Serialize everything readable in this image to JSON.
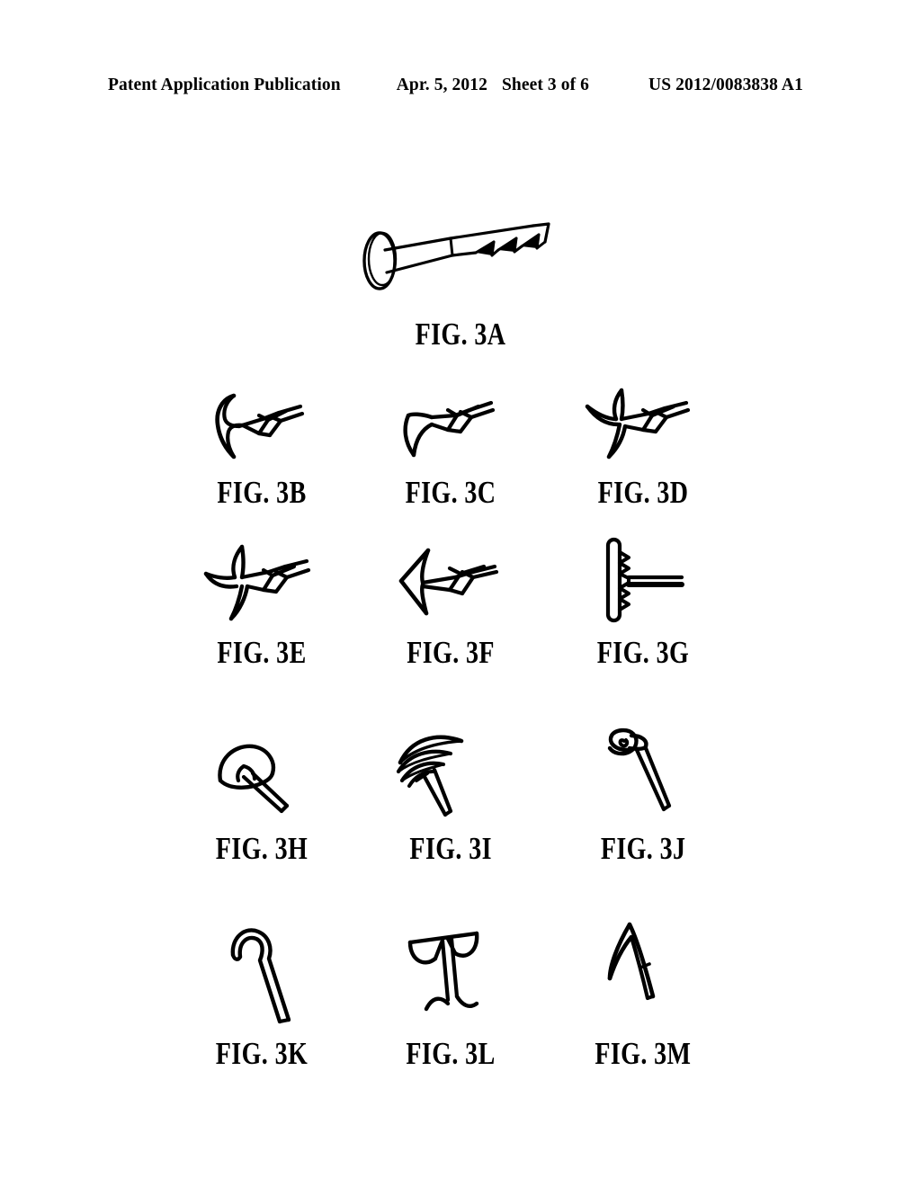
{
  "page": {
    "background_color": "#ffffff",
    "ink_color": "#000000"
  },
  "header": {
    "publication_title": "Patent Application Publication",
    "date": "Apr. 5, 2012",
    "sheet": "Sheet 3 of 6",
    "publication_number": "US 2012/0083838 A1"
  },
  "figures": [
    {
      "id": "3A",
      "label": "FIG. 3A",
      "icon": "barbed-shaft-with-disc-head-figure",
      "description": "Elongate anchor shaft with a round disc-shaped head at the proximal end and a series of rearward-facing barbs along the distal portion"
    },
    {
      "id": "3B",
      "label": "FIG. 3B",
      "icon": "hooked-tip-barbed-anchor-figure",
      "description": "Anchor with a curved hook-shaped distal tip and two rearward-facing barbs on the shaft"
    },
    {
      "id": "3C",
      "label": "FIG. 3C",
      "icon": "curved-blade-tip-barbed-anchor-figure",
      "description": "Anchor with a slender curved blade tip and two rearward-facing barbs on the shaft"
    },
    {
      "id": "3D",
      "label": "FIG. 3D",
      "icon": "three-prong-tip-barbed-anchor-figure",
      "description": "Anchor with a three-pronged splayed distal tip and rearward-facing barbs on the shaft"
    },
    {
      "id": "3E",
      "label": "FIG. 3E",
      "icon": "four-prong-tip-barbed-anchor-figure",
      "description": "Anchor with a four-pronged splayed distal tip and rearward-facing barbs on the shaft"
    },
    {
      "id": "3F",
      "label": "FIG. 3F",
      "icon": "arrowhead-tip-barbed-anchor-figure",
      "description": "Anchor with a chevron arrowhead distal tip and two rearward-facing barbs on the shaft"
    },
    {
      "id": "3G",
      "label": "FIG. 3G",
      "icon": "t-bar-toggle-anchor-figure",
      "description": "T-shaped toggle anchor with a vertical crossbar and a serrated zigzag connection to the lateral shaft"
    },
    {
      "id": "3H",
      "label": "FIG. 3H",
      "icon": "mushroom-cap-anchor-figure",
      "description": "Anchor with a mushroom or umbrella shaped cap mounted on an angled shaft"
    },
    {
      "id": "3I",
      "label": "FIG. 3I",
      "icon": "splayed-umbrella-rib-anchor-figure",
      "description": "Anchor with multiple splayed radiating ribs forming a fanned umbrella at the end of a shaft"
    },
    {
      "id": "3J",
      "label": "FIG. 3J",
      "icon": "coiled-loop-head-anchor-figure",
      "description": "Anchor with a coiled spiral loop head at the proximal end of a straight shaft"
    },
    {
      "id": "3K",
      "label": "FIG. 3K",
      "icon": "shepherds-hook-anchor-figure",
      "description": "Anchor formed as a shepherd's crook with a rounded hook at the proximal end of a straight shaft"
    },
    {
      "id": "3L",
      "label": "FIG. 3L",
      "icon": "t-shaped-wing-anchor-figure",
      "description": "T-shaped anchor with wide curved lateral wings at the top and an undulating wave at the lower shaft"
    },
    {
      "id": "3M",
      "label": "FIG. 3M",
      "icon": "single-barb-harpoon-anchor-figure",
      "description": "Anchor with a single elongate harpoon barb folded back along the shaft"
    }
  ]
}
